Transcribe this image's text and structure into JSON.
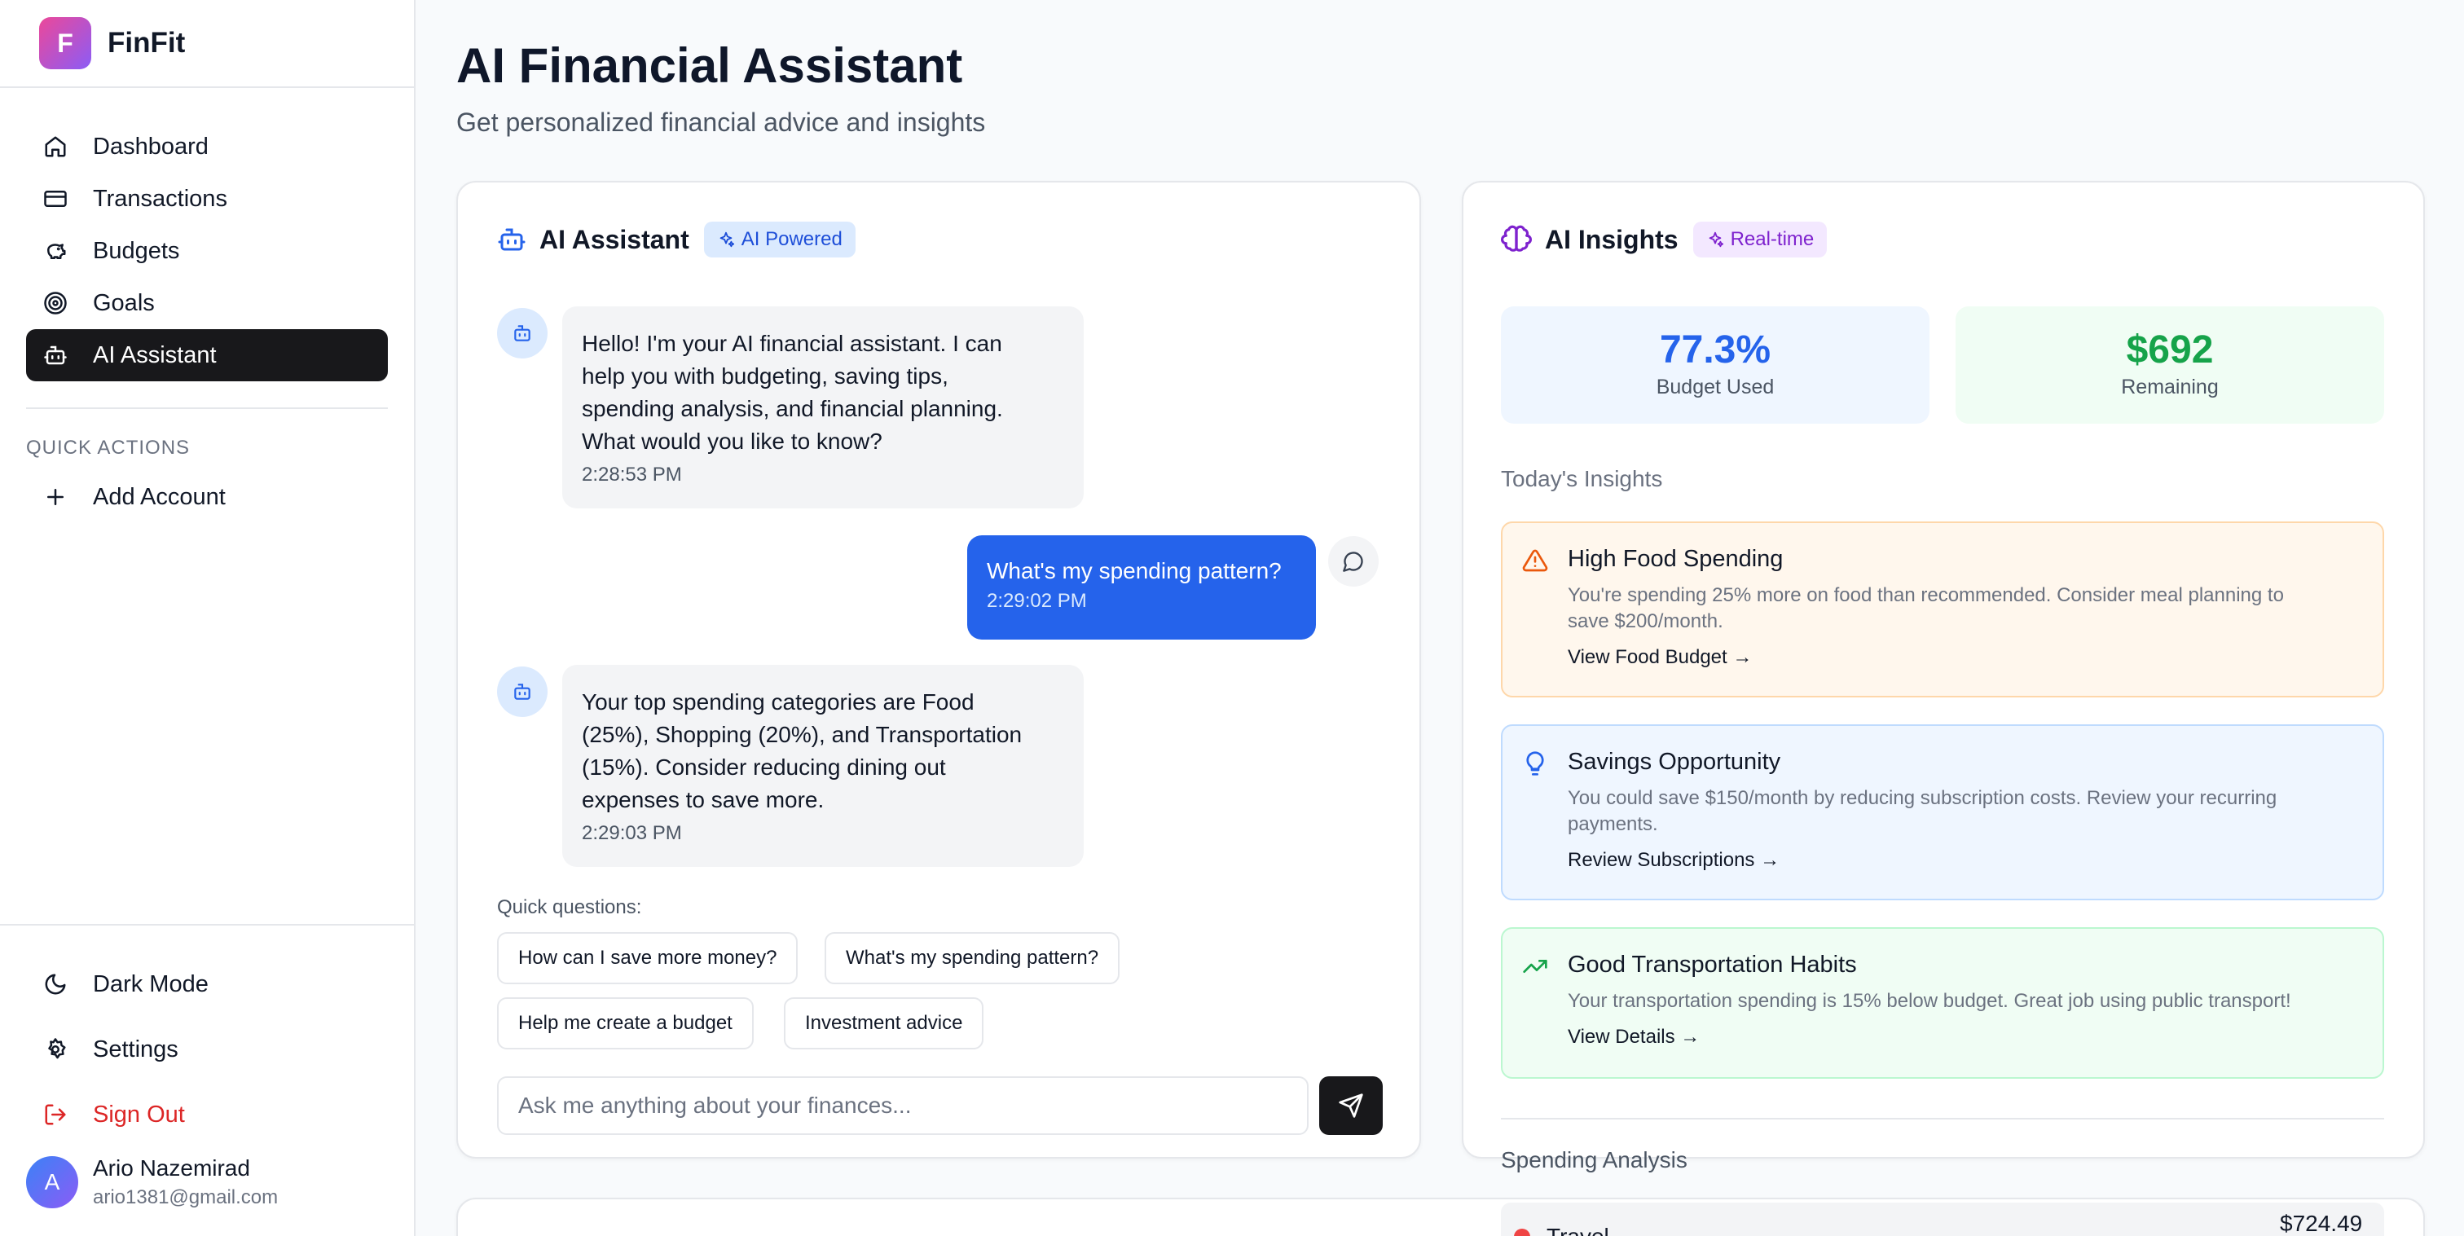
{
  "app": {
    "logo_letter": "F",
    "name": "FinFit"
  },
  "sidebar": {
    "items": [
      {
        "label": "Dashboard",
        "icon": "home-icon"
      },
      {
        "label": "Transactions",
        "icon": "credit-card-icon"
      },
      {
        "label": "Budgets",
        "icon": "piggy-bank-icon"
      },
      {
        "label": "Goals",
        "icon": "target-icon"
      },
      {
        "label": "AI Assistant",
        "icon": "bot-icon",
        "active": true
      }
    ],
    "quick_actions_heading": "QUICK ACTIONS",
    "quick_actions": [
      {
        "label": "Add Account",
        "icon": "plus-icon"
      }
    ],
    "bottom": {
      "dark_mode": "Dark Mode",
      "settings": "Settings",
      "sign_out": "Sign Out"
    },
    "user": {
      "initial": "A",
      "name": "Ario Nazemirad",
      "email": "ario1381@gmail.com"
    }
  },
  "header": {
    "title": "AI Financial Assistant",
    "subtitle": "Get personalized financial advice and insights"
  },
  "assistant": {
    "title": "AI Assistant",
    "badge": "AI Powered",
    "messages": [
      {
        "from": "bot",
        "lines": [
          "Hello! I'm your AI financial assistant. I can",
          "help you with budgeting, saving tips,",
          "spending analysis, and financial planning.",
          "What would you like to know?"
        ],
        "time": "2:28:53 PM"
      },
      {
        "from": "user",
        "lines": [
          "What's my spending pattern?"
        ],
        "time": "2:29:02 PM"
      },
      {
        "from": "bot",
        "lines": [
          "Your top spending categories are Food",
          "(25%), Shopping (20%), and Transportation",
          "(15%). Consider reducing dining out",
          "expenses to save more."
        ],
        "time": "2:29:03 PM"
      }
    ],
    "quick_questions_label": "Quick questions:",
    "quick_questions": [
      "How can I save more money?",
      "What's my spending pattern?",
      "Help me create a budget",
      "Investment advice"
    ],
    "input_placeholder": "Ask me anything about your finances..."
  },
  "insights": {
    "title": "AI Insights",
    "badge": "Real-time",
    "stats": [
      {
        "value": "77.3%",
        "label": "Budget Used",
        "color": "#2563eb",
        "bg": "#eff6ff"
      },
      {
        "value": "$692",
        "label": "Remaining",
        "color": "#16a34a",
        "bg": "#f0fdf4"
      }
    ],
    "todays_label": "Today's Insights",
    "cards": [
      {
        "title": "High Food Spending",
        "desc_lines": [
          "You're spending 25% more on food than recommended. Consider meal planning to",
          "save $200/month."
        ],
        "link": "View Food Budget →",
        "icon": "alert-triangle-icon",
        "bg": "#fff7ed",
        "border": "#fed7aa"
      },
      {
        "title": "Savings Opportunity",
        "desc_lines": [
          "You could save $150/month by reducing subscription costs. Review your recurring",
          "payments."
        ],
        "link": "Review Subscriptions →",
        "icon": "lightbulb-icon",
        "bg": "#eff6ff",
        "border": "#bfdbfe"
      },
      {
        "title": "Good Transportation Habits",
        "desc_lines": [
          "Your transportation spending is 15% below budget. Great job using public transport!"
        ],
        "link": "View Details →",
        "icon": "trending-up-icon",
        "bg": "#f0fdf4",
        "border": "#bbf7d0"
      }
    ],
    "spending_label": "Spending Analysis",
    "spending_first": {
      "category": "Travel",
      "amount": "$724.49"
    }
  }
}
